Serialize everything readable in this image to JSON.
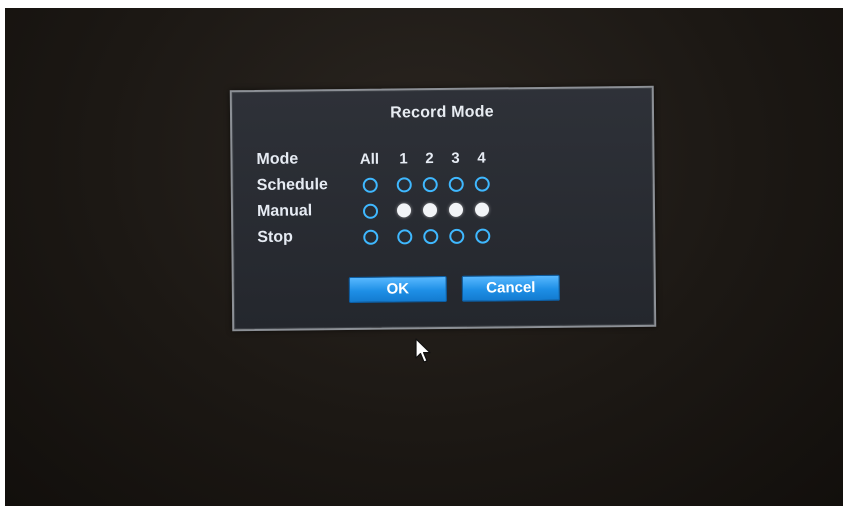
{
  "dialog": {
    "title": "Record Mode",
    "header": {
      "mode_label": "Mode",
      "all_label": "All",
      "channels": [
        "1",
        "2",
        "3",
        "4"
      ]
    },
    "rows": [
      {
        "label": "Schedule",
        "all": false,
        "channels": [
          false,
          false,
          false,
          false
        ]
      },
      {
        "label": "Manual",
        "all": false,
        "channels": [
          true,
          true,
          true,
          true
        ]
      },
      {
        "label": "Stop",
        "all": false,
        "channels": [
          false,
          false,
          false,
          false
        ]
      }
    ],
    "ok_label": "OK",
    "cancel_label": "Cancel"
  },
  "colors": {
    "accent": "#1e8fe6",
    "radio_ring": "#3fb8ff",
    "radio_selected": "#f2f4f7",
    "text": "#e6ebf3"
  },
  "icons": {
    "radio_unselected": "radio-unselected-icon",
    "radio_selected": "radio-selected-icon",
    "pointer": "mouse-pointer-icon"
  }
}
